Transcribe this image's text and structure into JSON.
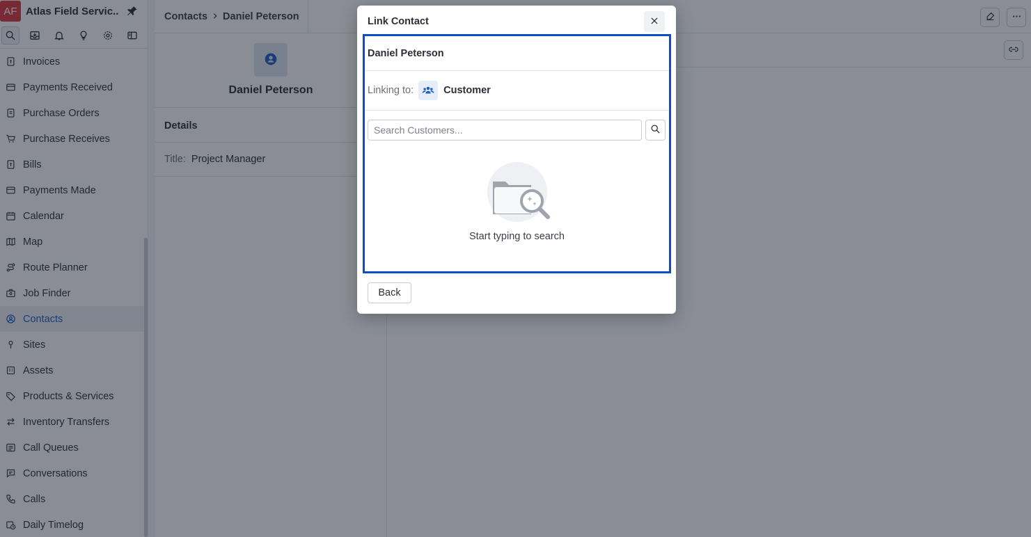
{
  "app": {
    "badge": "AF",
    "name": "Atlas Field Servic..."
  },
  "sidebar": {
    "items": [
      {
        "label": "Invoices",
        "icon": "invoice-icon"
      },
      {
        "label": "Payments Received",
        "icon": "card-icon"
      },
      {
        "label": "Purchase Orders",
        "icon": "purchase-order-icon"
      },
      {
        "label": "Purchase Receives",
        "icon": "cart-icon"
      },
      {
        "label": "Bills",
        "icon": "bill-icon"
      },
      {
        "label": "Payments Made",
        "icon": "card-icon"
      },
      {
        "label": "Calendar",
        "icon": "calendar-icon"
      },
      {
        "label": "Map",
        "icon": "map-icon"
      },
      {
        "label": "Route Planner",
        "icon": "route-icon"
      },
      {
        "label": "Job Finder",
        "icon": "job-finder-icon"
      },
      {
        "label": "Contacts",
        "icon": "contact-icon",
        "active": true
      },
      {
        "label": "Sites",
        "icon": "pin-icon"
      },
      {
        "label": "Assets",
        "icon": "asset-icon"
      },
      {
        "label": "Products & Services",
        "icon": "tag-icon"
      },
      {
        "label": "Inventory Transfers",
        "icon": "transfer-icon"
      },
      {
        "label": "Call Queues",
        "icon": "queue-icon"
      },
      {
        "label": "Conversations",
        "icon": "chat-icon"
      },
      {
        "label": "Calls",
        "icon": "phone-icon"
      },
      {
        "label": "Daily Timelog",
        "icon": "timelog-icon"
      }
    ]
  },
  "header": {
    "crumb_root": "Contacts",
    "crumb_current": "Daniel Peterson"
  },
  "contact": {
    "name": "Daniel Peterson",
    "details_heading": "Details",
    "title_label": "Title:",
    "title_value": "Project Manager"
  },
  "modal": {
    "title": "Link Contact",
    "contact_name": "Daniel Peterson",
    "linking_label": "Linking to:",
    "linking_value": "Customer",
    "search_placeholder": "Search Customers...",
    "empty_text": "Start typing to search",
    "back_label": "Back"
  },
  "colors": {
    "accent": "#1f5fbf",
    "highlight": "#0b4ec9",
    "brand": "#d8393d"
  }
}
